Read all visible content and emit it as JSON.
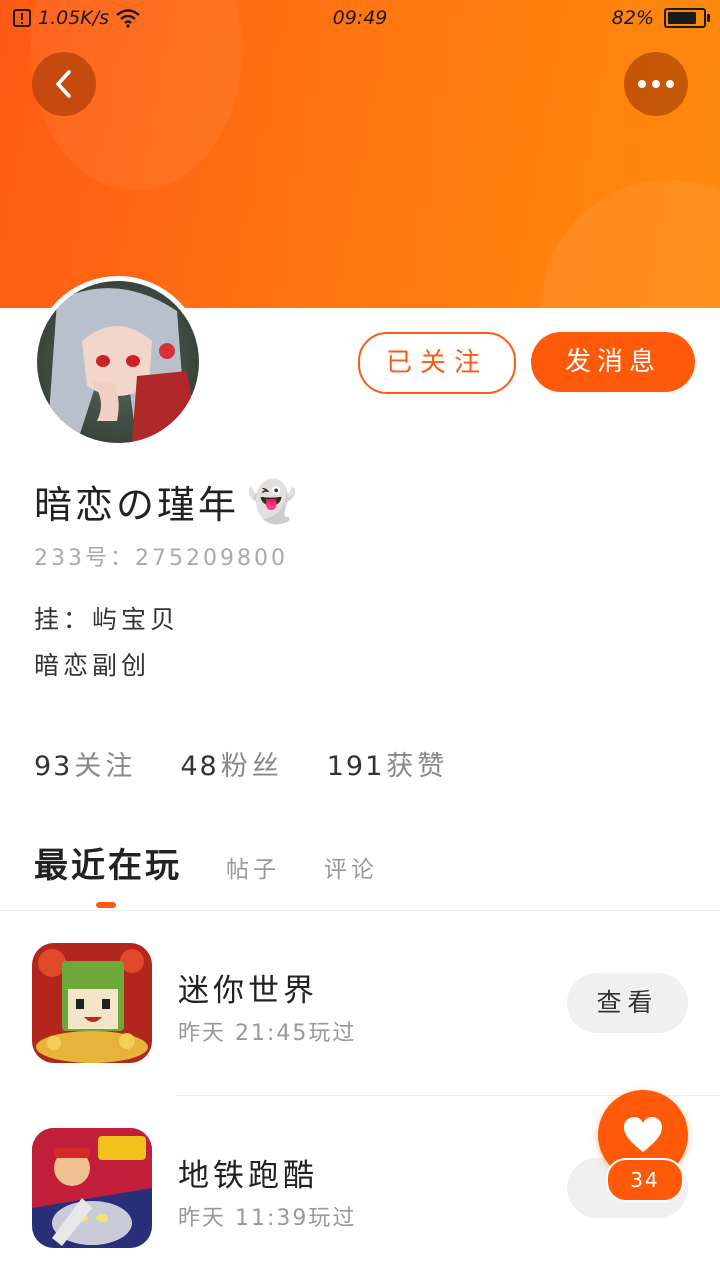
{
  "status_bar": {
    "net_speed": "1.05K/s",
    "time": "09:49",
    "battery": "82%",
    "battery_level": 0.82
  },
  "header": {
    "back_icon": "chevron-left-icon",
    "more_icon": "more-dots-icon",
    "accent_color": "#ff5a14"
  },
  "profile": {
    "username": "暗恋の瑾年",
    "emoji": "👻",
    "id_line": "233号：275209800",
    "bio_lines": [
      "挂：屿宝贝",
      "暗恋副创"
    ],
    "follow_label": "已关注",
    "message_label": "发消息"
  },
  "stats": [
    {
      "value": "93",
      "label": "关注"
    },
    {
      "value": "48",
      "label": "粉丝"
    },
    {
      "value": "191",
      "label": "获赞"
    }
  ],
  "tabs": {
    "active": "最近在玩",
    "others": [
      "帖子",
      "评论"
    ]
  },
  "games": [
    {
      "name": "迷你世界",
      "played": "昨天 21:45玩过",
      "action": "查看"
    },
    {
      "name": "地铁跑酷",
      "played": "昨天 11:39玩过",
      "action": "查"
    }
  ],
  "like": {
    "icon": "heart-icon",
    "count": "34"
  }
}
